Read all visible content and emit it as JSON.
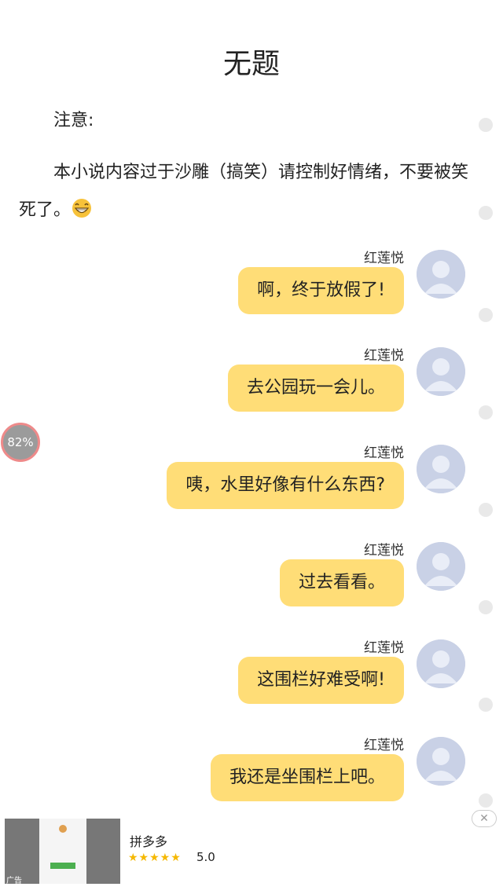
{
  "article": {
    "title": "无题",
    "note_label": "注意:",
    "intro_text": "本小说内容过于沙雕（搞笑）请控制好情绪，不要被笑死了。",
    "intro_emoji": "grinning-face-icon"
  },
  "messages": [
    {
      "sender": "红莲悦",
      "text": "啊，终于放假了!"
    },
    {
      "sender": "红莲悦",
      "text": "去公园玩一会儿。"
    },
    {
      "sender": "红莲悦",
      "text": "咦，水里好像有什么东西?"
    },
    {
      "sender": "红莲悦",
      "text": "过去看看。"
    },
    {
      "sender": "红莲悦",
      "text": "这围栏好难受啊!"
    },
    {
      "sender": "红莲悦",
      "text": "我还是坐围栏上吧。"
    }
  ],
  "reading_progress": {
    "label": "82%",
    "value": 0.82
  },
  "ad": {
    "app_name": "拼多多",
    "rating": "5.0",
    "stars": 5,
    "tag": "广告",
    "close_icon": "close-icon"
  },
  "colors": {
    "bubble": "#ffdd77",
    "avatar": "#c9d1e6",
    "progress_ring": "#ee8a8a"
  }
}
